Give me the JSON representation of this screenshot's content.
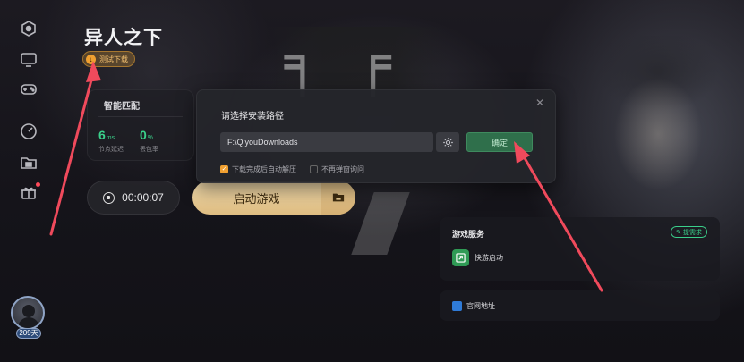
{
  "sidebar": {
    "icons": [
      "home-icon",
      "monitor-icon",
      "gamepad-icon",
      "speedometer-icon",
      "folder-icon",
      "gift-icon"
    ],
    "user": {
      "days_label": "209天"
    }
  },
  "game": {
    "title": "异人之下",
    "badge": "测试下载"
  },
  "match": {
    "title": "智能匹配",
    "latency_value": "6",
    "latency_unit": "ms",
    "latency_label": "节点延迟",
    "loss_value": "0",
    "loss_unit": "%",
    "loss_label": "丢包率"
  },
  "timer": {
    "value": "00:00:07"
  },
  "launch": {
    "label": "启动游戏"
  },
  "dialog": {
    "title": "请选择安装路径",
    "path_value": "F:\\QiyouDownloads",
    "confirm_label": "确定",
    "auto_extract_label": "下载完成后自动解压",
    "auto_extract_checked": true,
    "no_ask_label": "不再弹窗询问",
    "no_ask_checked": false
  },
  "services": {
    "title": "游戏服务",
    "request_label": "提需求",
    "items": [
      {
        "label": "快游启动",
        "icon": "quick-launch-icon"
      }
    ]
  },
  "website": {
    "label": "官网地址"
  },
  "colors": {
    "accent_green": "#3ad08a",
    "confirm_bg": "#2f6f4b",
    "launch_gold": "#e7c891",
    "badge_orange": "#f0a030",
    "annotation_red": "#f04a5c"
  }
}
